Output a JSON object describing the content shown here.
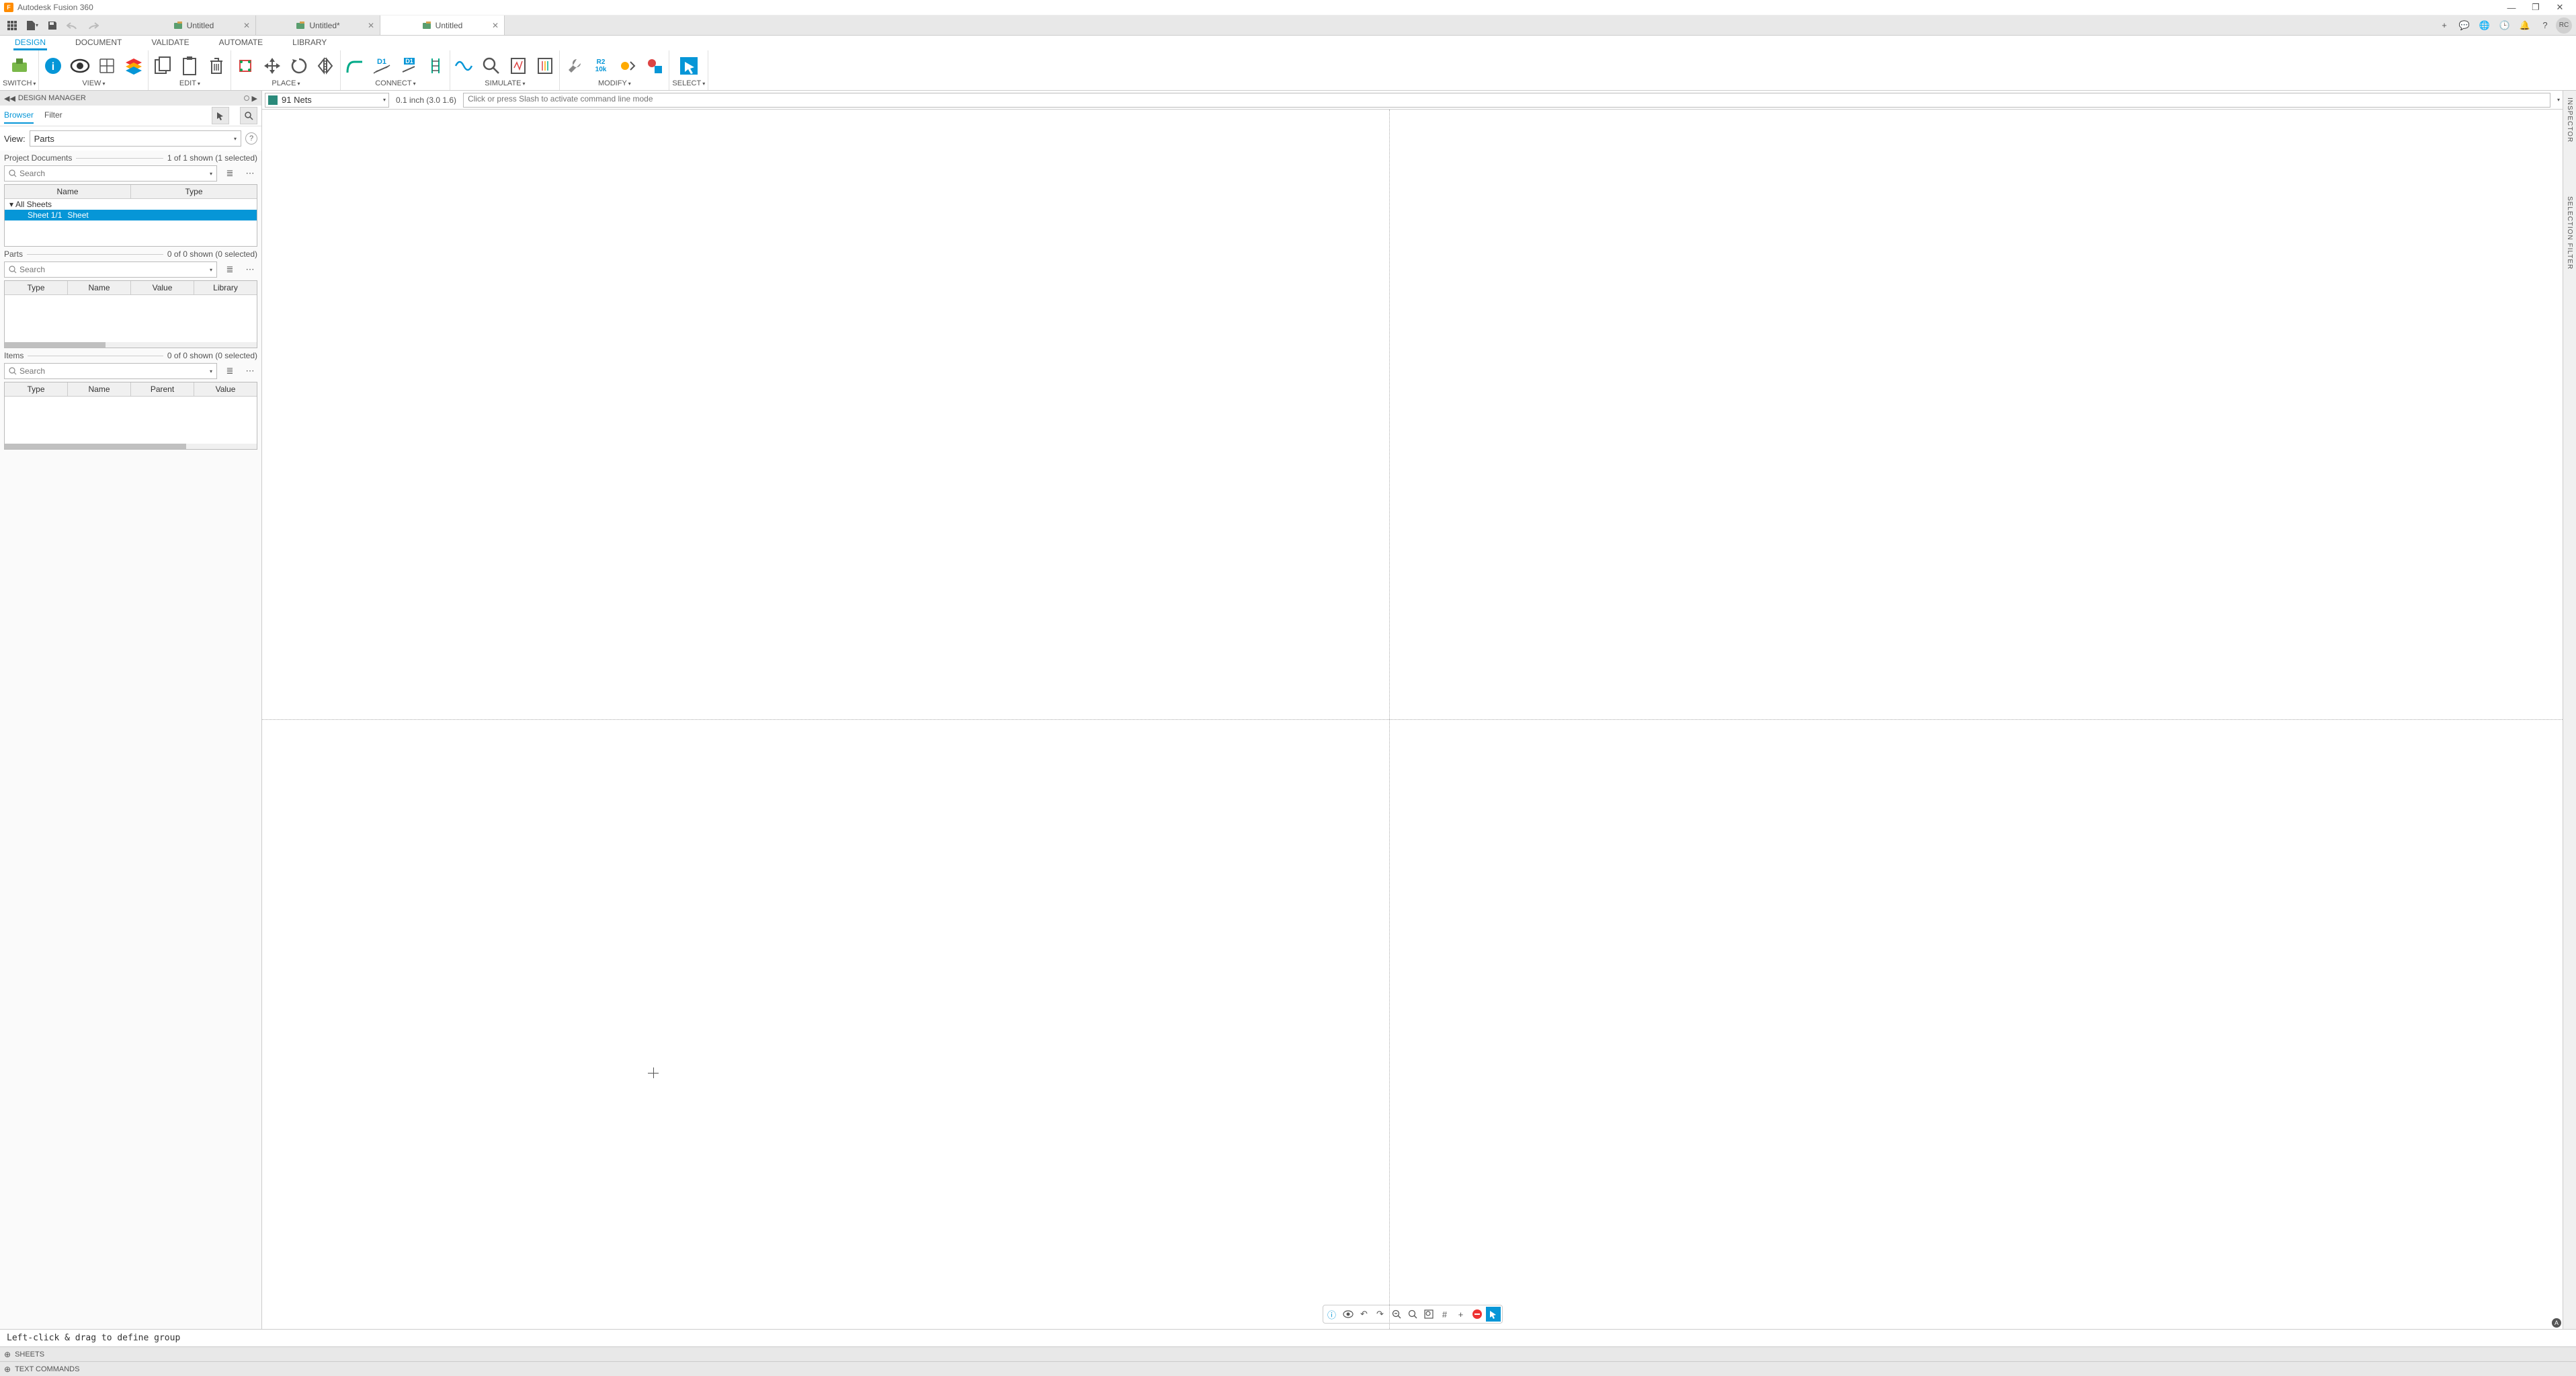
{
  "app": {
    "title": "Autodesk Fusion 360",
    "avatar": "RC"
  },
  "window_buttons": {
    "min": "—",
    "max": "❐",
    "close": "✕"
  },
  "doc_tabs": [
    {
      "label": "Untitled",
      "modified": false,
      "active": false
    },
    {
      "label": "Untitled*",
      "modified": true,
      "active": false
    },
    {
      "label": "Untitled",
      "modified": false,
      "active": true
    }
  ],
  "qat_right": {
    "add": "+",
    "comments": "💬",
    "globe": "🌐",
    "clock": "🕒",
    "bell": "🔔",
    "help": "?"
  },
  "ribbon_tabs": [
    {
      "label": "DESIGN",
      "active": true
    },
    {
      "label": "DOCUMENT",
      "active": false
    },
    {
      "label": "VALIDATE",
      "active": false
    },
    {
      "label": "AUTOMATE",
      "active": false
    },
    {
      "label": "LIBRARY",
      "active": false
    }
  ],
  "ribbon_groups": [
    {
      "label": "SWITCH",
      "dropdown": true,
      "icons": [
        "switch-icon"
      ]
    },
    {
      "label": "VIEW",
      "dropdown": true,
      "icons": [
        "info-icon",
        "eye-icon",
        "grid-icon",
        "layers-icon"
      ]
    },
    {
      "label": "EDIT",
      "dropdown": true,
      "icons": [
        "copy-icon",
        "paste-icon",
        "trash-icon"
      ]
    },
    {
      "label": "PLACE",
      "dropdown": true,
      "icons": [
        "insert-icon",
        "move-icon",
        "rotate-icon",
        "mirror-icon"
      ]
    },
    {
      "label": "CONNECT",
      "dropdown": true,
      "icons": [
        "wire-icon",
        "d1-icon",
        "d1b-icon",
        "bus-icon"
      ]
    },
    {
      "label": "SIMULATE",
      "dropdown": true,
      "icons": [
        "wave-icon",
        "probe-icon",
        "sim1-icon",
        "sim2-icon"
      ]
    },
    {
      "label": "MODIFY",
      "dropdown": true,
      "icons": [
        "wrench-icon",
        "r210k-icon",
        "swap1-icon",
        "swap2-icon"
      ]
    },
    {
      "label": "SELECT",
      "dropdown": true,
      "icons": [
        "select-icon"
      ]
    }
  ],
  "design_manager": {
    "title": "DESIGN MANAGER",
    "tabs": {
      "browser": "Browser",
      "filter": "Filter"
    },
    "view_label": "View:",
    "view_value": "Parts",
    "search_placeholder": "Search",
    "sections": {
      "docs": {
        "title": "Project Documents",
        "count": "1 of 1 shown (1 selected)",
        "cols": [
          "Name",
          "Type"
        ],
        "tree": [
          {
            "label": "All Sheets",
            "expanded": true,
            "children": [
              {
                "label": "Sheet 1/1",
                "type": "Sheet",
                "selected": true
              }
            ]
          }
        ]
      },
      "parts": {
        "title": "Parts",
        "count": "0 of 0 shown (0 selected)",
        "cols": [
          "Type",
          "Name",
          "Value",
          "Library"
        ]
      },
      "items": {
        "title": "Items",
        "count": "0 of 0 shown (0 selected)",
        "cols": [
          "Type",
          "Name",
          "Parent",
          "Value"
        ]
      }
    }
  },
  "canvas_bar": {
    "nets_label": "91 Nets",
    "dim": "0.1 inch (3.0 1.6)",
    "cmd_placeholder": "Click or press Slash to activate command line mode"
  },
  "right_rail": {
    "inspector": "INSPECTOR",
    "selection": "SELECTION FILTER"
  },
  "tip_text": "Left-click & drag to define group",
  "bottom_panels": [
    "SHEETS",
    "TEXT COMMANDS"
  ]
}
